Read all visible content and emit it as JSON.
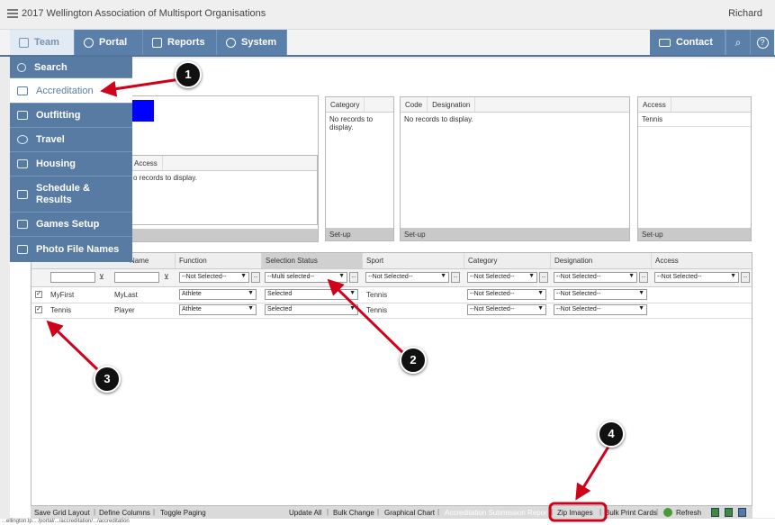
{
  "app": {
    "title": "2017 Wellington Association of Multisport Organisations",
    "user": "Richard"
  },
  "nav": {
    "tabs": [
      {
        "label": "Team",
        "icon": "team-icon"
      },
      {
        "label": "Portal",
        "icon": "globe-icon"
      },
      {
        "label": "Reports",
        "icon": "reports-icon"
      },
      {
        "label": "System",
        "icon": "gear-icon"
      }
    ],
    "contact": "Contact",
    "search_icon": "⌕",
    "help_icon": "?"
  },
  "menu": {
    "items": [
      {
        "label": "Search",
        "icon": "search-icon"
      },
      {
        "label": "Accreditation",
        "icon": "id-card-icon"
      },
      {
        "label": "Outfitting",
        "icon": "shirt-icon"
      },
      {
        "label": "Travel",
        "icon": "plane-icon"
      },
      {
        "label": "Housing",
        "icon": "home-icon"
      },
      {
        "label": "Schedule & Results",
        "icon": "calendar-icon"
      },
      {
        "label": "Games Setup",
        "icon": "wrench-icon"
      },
      {
        "label": "Photo File Names",
        "icon": "wrench-icon"
      }
    ]
  },
  "panels": {
    "access_left": {
      "header": "Access",
      "empty": "o records to display."
    },
    "category": {
      "header": "Category",
      "empty": "No records to display.",
      "footer": "Set-up"
    },
    "code": {
      "header_code": "Code",
      "header_designation": "Designation",
      "empty": "No records to display.",
      "footer": "Set-up"
    },
    "access_right": {
      "header": "Access",
      "row": "Tennis",
      "footer": "Set-up"
    },
    "colors": {
      "swatch": "#0000ff"
    }
  },
  "grid": {
    "headers": [
      "Name",
      "Function",
      "Selection Status",
      "Sport",
      "Category",
      "Designation",
      "Access"
    ],
    "filters": {
      "function": "--Not Selected--",
      "selection_status": "--Multi selected--",
      "sport": "--Not Selected--",
      "category": "--Not Selected--",
      "designation": "--Not Selected--",
      "access": "--Not Selected--"
    },
    "rows": [
      {
        "first": "MyFirst",
        "last": "MyLast",
        "function": "Athlete",
        "status": "Selected",
        "sport": "Tennis",
        "category": "--Not Selected--",
        "designation": "--Not Selected--"
      },
      {
        "first": "Tennis",
        "last": "Player",
        "function": "Athlete",
        "status": "Selected",
        "sport": "Tennis",
        "category": "--Not Selected--",
        "designation": "--Not Selected--"
      }
    ]
  },
  "footer": {
    "save_grid_layout": "Save Grid Layout",
    "define_columns": "Define Columns",
    "toggle_paging": "Toggle Paging",
    "update_all": "Update All",
    "bulk_change": "Bulk Change",
    "graphical_chart": "Graphical Chart",
    "accreditation_submission": "Accreditation Submission Repor",
    "zip_images": "Zip Images",
    "bulk_print_cards": "Bulk Print Cards",
    "refresh": "Refresh"
  },
  "annotations": {
    "one": "1",
    "two": "2",
    "three": "3",
    "four": "4",
    "color": "#d0021b"
  },
  "statusbar": "...ellington.lp... /portal/.../accreditation/.../accreditation"
}
